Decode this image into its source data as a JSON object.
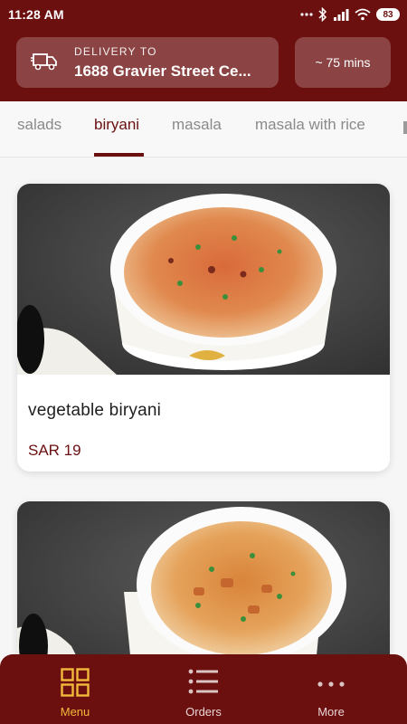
{
  "status_bar": {
    "time": "11:28 AM",
    "battery": "83"
  },
  "header": {
    "delivery_label": "DELIVERY TO",
    "delivery_address": "1688 Gravier Street Ce...",
    "eta": "~ 75 mins"
  },
  "tabs": [
    {
      "label": "salads"
    },
    {
      "label": "biryani",
      "active": true
    },
    {
      "label": "masala"
    },
    {
      "label": "masala with rice"
    }
  ],
  "menu_items": [
    {
      "name": "vegetable biryani",
      "price": "SAR 19"
    },
    {
      "name": "",
      "price": ""
    }
  ],
  "bottom_nav": [
    {
      "label": "Menu",
      "icon": "grid-icon",
      "active": true
    },
    {
      "label": "Orders",
      "icon": "list-icon"
    },
    {
      "label": "More",
      "icon": "more-dots-icon"
    }
  ],
  "colors": {
    "primary": "#6b0f0f",
    "accent": "#f2b93b"
  }
}
